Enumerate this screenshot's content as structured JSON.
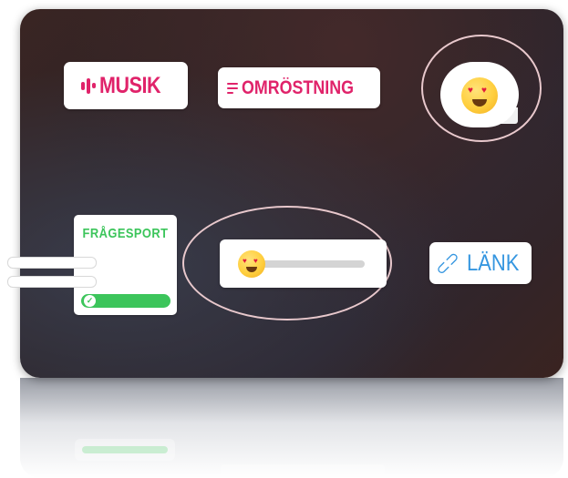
{
  "stickers": {
    "music": {
      "label": "MUSIK",
      "icon": "music-wave-icon",
      "color": "#e0236a"
    },
    "poll": {
      "label": "OMRÖSTNING",
      "icon": "poll-lines-icon",
      "color": "#e0236a"
    },
    "emoji": {
      "icon": "heart-eyes-emoji-icon"
    },
    "quiz": {
      "title": "FRÅGESPORT",
      "color": "#3cc55b"
    },
    "emoji_slider": {
      "icon": "heart-eyes-emoji-icon",
      "value": 0.1
    },
    "link": {
      "label": "LÄNK",
      "icon": "link-icon",
      "color": "#3596e0"
    }
  },
  "highlight_color": "#e8c8cc"
}
